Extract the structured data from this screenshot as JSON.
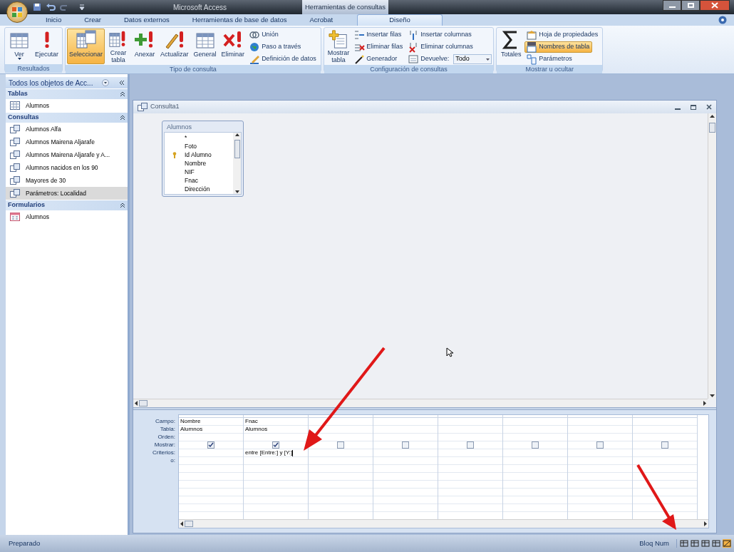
{
  "title_bar": {
    "title": "Microsoft Access",
    "context_title": "Herramientas de consultas"
  },
  "ribbon_tabs": [
    {
      "label": "Inicio",
      "selected": false
    },
    {
      "label": "Crear",
      "selected": false
    },
    {
      "label": "Datos externos",
      "selected": false
    },
    {
      "label": "Herramientas de base de datos",
      "selected": false
    },
    {
      "label": "Acrobat",
      "selected": false
    },
    {
      "label": "Diseño",
      "selected": true
    }
  ],
  "ribbon_groups": [
    {
      "label": "Resultados",
      "buttons": [
        {
          "kind": "large",
          "label": "Ver",
          "caret": true,
          "selected": false
        },
        {
          "kind": "large",
          "label": "Ejecutar",
          "selected": false
        }
      ]
    },
    {
      "label": "Tipo de consulta",
      "buttons": [
        {
          "kind": "large",
          "label": "Seleccionar",
          "selected": true
        },
        {
          "kind": "large",
          "label": "Crear\ntabla",
          "selected": false
        },
        {
          "kind": "large",
          "label": "Anexar",
          "selected": false
        },
        {
          "kind": "large",
          "label": "Actualizar",
          "selected": false
        },
        {
          "kind": "large",
          "label": "General",
          "selected": false
        },
        {
          "kind": "large",
          "label": "Eliminar",
          "selected": false
        },
        {
          "kind": "small",
          "label": "Unión",
          "selected": false
        },
        {
          "kind": "small",
          "label": "Paso a través",
          "selected": false
        },
        {
          "kind": "small",
          "label": "Definición de datos",
          "selected": false
        }
      ]
    },
    {
      "label": "Configuración de consultas",
      "buttons": [
        {
          "kind": "large",
          "label": "Mostrar\ntabla",
          "selected": false
        },
        {
          "kind": "small",
          "label": "Insertar filas",
          "selected": false
        },
        {
          "kind": "small",
          "label": "Eliminar filas",
          "selected": false
        },
        {
          "kind": "small",
          "label": "Generador",
          "selected": false
        },
        {
          "kind": "small",
          "label": "Insertar columnas",
          "selected": false
        },
        {
          "kind": "small",
          "label": "Eliminar columnas",
          "selected": false
        },
        {
          "kind": "dropdown",
          "label": "Devuelve:",
          "value": "Todo",
          "selected": false
        }
      ]
    },
    {
      "label": "Mostrar u ocultar",
      "buttons": [
        {
          "kind": "large",
          "label": "Totales",
          "selected": false
        },
        {
          "kind": "small",
          "label": "Hoja de propiedades",
          "selected": false
        },
        {
          "kind": "small",
          "label": "Nombres de tabla",
          "selected": true
        },
        {
          "kind": "small",
          "label": "Parámetros",
          "selected": false
        }
      ]
    }
  ],
  "nav_pane": {
    "header": "Todos los objetos de Acc...",
    "groups": [
      {
        "label": "Tablas",
        "kind": "table",
        "items": [
          {
            "label": "Alumnos",
            "selected": false
          }
        ]
      },
      {
        "label": "Consultas",
        "kind": "query",
        "items": [
          {
            "label": "Alumnos Alfa",
            "selected": false
          },
          {
            "label": "Alumnos Mairena Aljarafe",
            "selected": false
          },
          {
            "label": "Alumnos Mairena Aljarafe y A...",
            "selected": false
          },
          {
            "label": "Alumnos nacidos en los 90",
            "selected": false
          },
          {
            "label": "Mayores de 30",
            "selected": false
          },
          {
            "label": "Parámetros: Localidad",
            "selected": true
          }
        ]
      },
      {
        "label": "Formularios",
        "kind": "form",
        "items": [
          {
            "label": "Alumnos",
            "selected": false
          }
        ]
      }
    ]
  },
  "query_window": {
    "title": "Consulta1",
    "table_box": {
      "title": "Alumnos",
      "fields": [
        {
          "label": "*",
          "primary_key": false
        },
        {
          "label": "Foto",
          "primary_key": false
        },
        {
          "label": "Id Alumno",
          "primary_key": true
        },
        {
          "label": "Nombre",
          "primary_key": false
        },
        {
          "label": "NIF",
          "primary_key": false
        },
        {
          "label": "Fnac",
          "primary_key": false
        },
        {
          "label": "Dirección",
          "primary_key": false
        }
      ]
    },
    "grid": {
      "row_labels": [
        "Campo:",
        "Tabla:",
        "Orden:",
        "Mostrar:",
        "Criterios:",
        "o:"
      ],
      "columns": [
        {
          "field": "Nombre",
          "table": "Alumnos",
          "show": true
        },
        {
          "field": "Fnac",
          "table": "Alumnos",
          "show": true,
          "criteria": "entre [Entre:] y [Y:]"
        },
        {
          "show": false
        },
        {
          "show": false
        },
        {
          "show": false
        },
        {
          "show": false
        },
        {
          "show": false
        },
        {
          "show": false
        }
      ]
    }
  },
  "status_bar": {
    "left": "Preparado",
    "right": "Bloq Num"
  }
}
